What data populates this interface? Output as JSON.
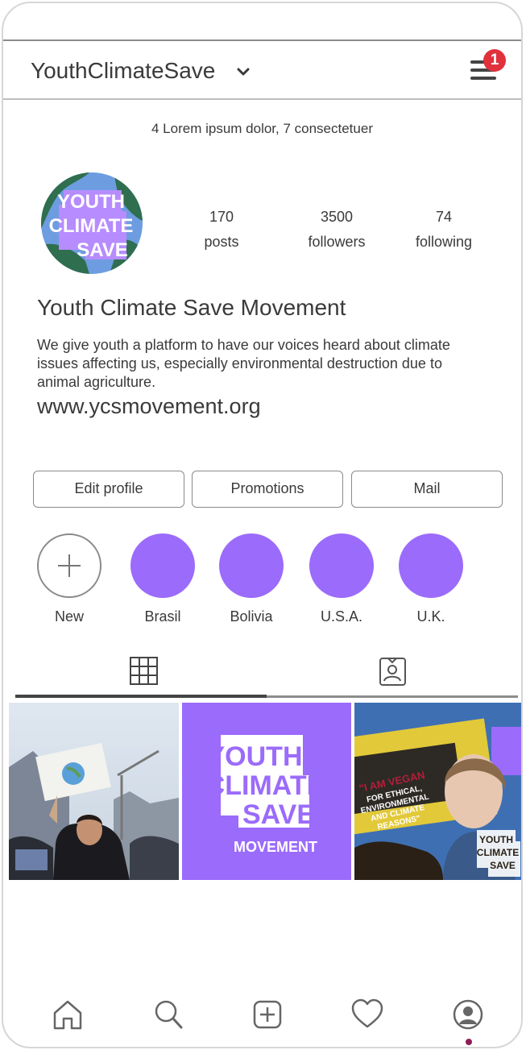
{
  "header": {
    "username": "YouthClimateSave",
    "notification_count": "1"
  },
  "profile": {
    "subtitle": "4 Lorem ipsum dolor, 7 consectetuer",
    "avatar_text": [
      "YOUTH",
      "CLIMATE",
      "SAVE"
    ],
    "stats": [
      {
        "value": "170",
        "label": "posts"
      },
      {
        "value": "3500",
        "label": "followers"
      },
      {
        "value": "74",
        "label": "following"
      }
    ],
    "name": "Youth Climate Save Movement",
    "bio": "We give youth a platform to have our voices heard about climate issues affecting us, especially environmental destruction due to animal agriculture.",
    "url": "www.ycsmovement.org"
  },
  "buttons": {
    "edit": "Edit profile",
    "promotions": "Promotions",
    "mail": "Mail"
  },
  "highlights": [
    {
      "label": "New"
    },
    {
      "label": "Brasil"
    },
    {
      "label": "Bolivia"
    },
    {
      "label": "U.S.A."
    },
    {
      "label": "U.K."
    }
  ],
  "posts": {
    "logo_lines": [
      "YOUTH",
      "CLIMATE",
      "SAVE"
    ],
    "logo_sub": "MOVEMENT",
    "sign_text": [
      "\"I AM VEGAN",
      "FOR ETHICAL,",
      "ENVIRONMENTAL",
      "AND CLIMATE",
      "REASONS\""
    ],
    "corner_logo": [
      "YOUTH",
      "CLIMATE",
      "SAVE"
    ]
  },
  "colors": {
    "accent": "#9b6bfb",
    "badge": "#e0323c",
    "earth_land": "#2f6e4f",
    "earth_sea": "#6d9de0",
    "active_dot": "#8e1d55"
  }
}
